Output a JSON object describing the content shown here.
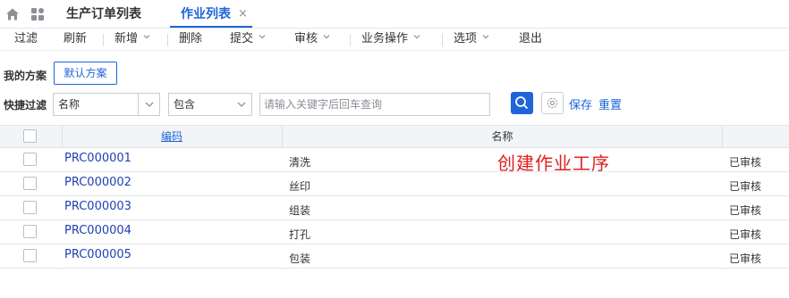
{
  "tabs": [
    {
      "label": "生产订单列表"
    },
    {
      "label": "作业列表",
      "close": "×"
    }
  ],
  "toolbar": {
    "items": [
      "过滤",
      "刷新",
      "新增",
      "删除",
      "提交",
      "审核",
      "业务操作",
      "选项",
      "退出"
    ]
  },
  "scheme": {
    "label": "我的方案",
    "default_button": "默认方案"
  },
  "quick_filter": {
    "label": "快捷过滤",
    "field_value": "名称",
    "operator_value": "包含",
    "search_placeholder": "请输入关键字后回车查询",
    "save_label": "保存",
    "reset_label": "重置"
  },
  "grid": {
    "columns": [
      "编码",
      "名称"
    ],
    "rows": [
      {
        "code": "PRC000001",
        "name": "清洗",
        "status": "已审核"
      },
      {
        "code": "PRC000002",
        "name": "丝印",
        "status": "已审核"
      },
      {
        "code": "PRC000003",
        "name": "组装",
        "status": "已审核"
      },
      {
        "code": "PRC000004",
        "name": "打孔",
        "status": "已审核"
      },
      {
        "code": "PRC000005",
        "name": "包装",
        "status": "已审核"
      }
    ]
  },
  "annotation": {
    "text": "创建作业工序",
    "color": "#e02020"
  },
  "colors": {
    "accent": "#1f64d8",
    "link": "#1f3fb3"
  },
  "icons": [
    "home-icon",
    "apps-icon",
    "close-icon",
    "chevron-down-icon",
    "search-icon",
    "gear-icon"
  ]
}
